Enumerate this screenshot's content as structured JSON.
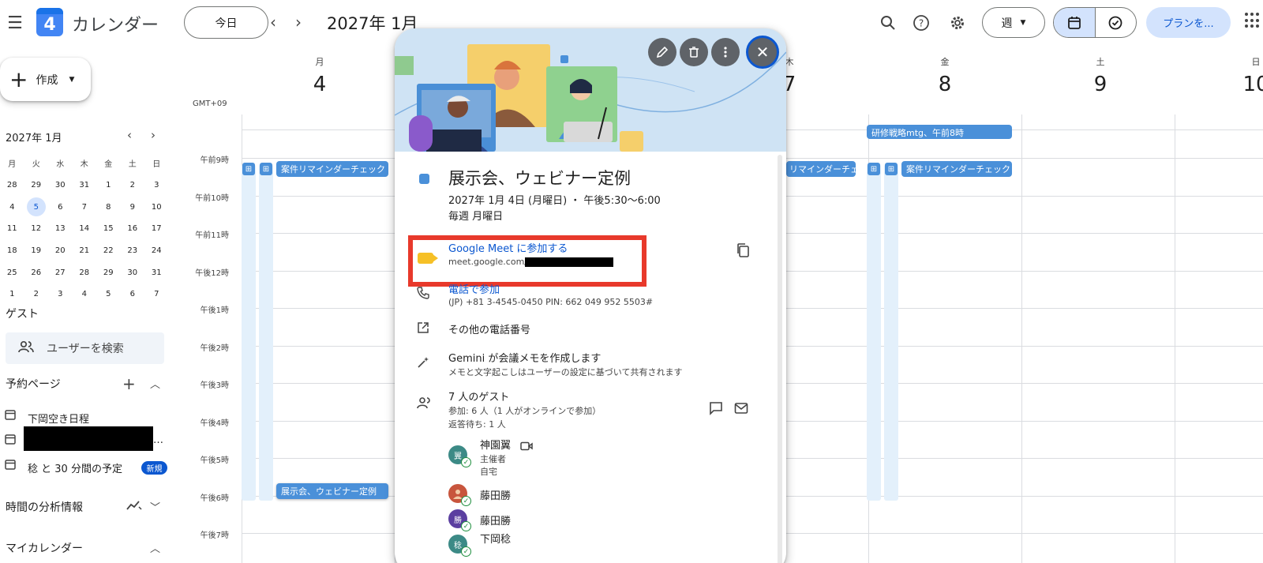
{
  "topbar": {
    "app_title": "カレンダー",
    "logo_day": "4",
    "today_label": "今日",
    "prev": "‹",
    "next": "›",
    "month_title": "2027年 1月",
    "view_label": "週",
    "plan_label": "プランを..."
  },
  "sidebar": {
    "create_label": "作成",
    "mini_title": "2027年 1月",
    "mini_prev": "‹",
    "mini_next": "›",
    "weekdays": [
      "月",
      "火",
      "水",
      "木",
      "金",
      "土",
      "日"
    ],
    "weeks": [
      [
        "28",
        "29",
        "30",
        "31",
        "1",
        "2",
        "3"
      ],
      [
        "4",
        "5",
        "6",
        "7",
        "8",
        "9",
        "10"
      ],
      [
        "11",
        "12",
        "13",
        "14",
        "15",
        "16",
        "17"
      ],
      [
        "18",
        "19",
        "20",
        "21",
        "22",
        "23",
        "24"
      ],
      [
        "25",
        "26",
        "27",
        "28",
        "29",
        "30",
        "31"
      ],
      [
        "1",
        "2",
        "3",
        "4",
        "5",
        "6",
        "7"
      ]
    ],
    "today_date": "5",
    "guest_heading": "ゲスト",
    "guest_search": "ユーザーを検索",
    "booking_heading": "予約ページ",
    "booking_items": [
      "下岡空き日程",
      "稔 と 30 分間の予定"
    ],
    "booking_ellipsis": "…",
    "new_badge": "新規",
    "insights_heading": "時間の分析情報",
    "mycal_heading": "マイカレンダー"
  },
  "grid": {
    "gmt_label": "GMT+09",
    "days": [
      {
        "dow": "月",
        "num": "4"
      },
      {
        "dow": "木",
        "num": "7"
      },
      {
        "dow": "金",
        "num": "8"
      },
      {
        "dow": "土",
        "num": "9"
      },
      {
        "dow": "日",
        "num": "10"
      }
    ],
    "times": [
      "午前9時",
      "午前10時",
      "午前11時",
      "午後12時",
      "午後1時",
      "午後2時",
      "午後3時",
      "午後4時",
      "午後5時",
      "午後6時",
      "午後7時"
    ],
    "events": {
      "reminder": "案件リマインダーチェック",
      "reminder_thu": "リマインダーチェック",
      "strategy": "研修戦略mtg、午前8時",
      "expo": "展示会、ウェビナー定例"
    },
    "mark_glyph": "⊞"
  },
  "popup": {
    "title": "展示会、ウェビナー定例",
    "datetime": "2027年 1月 4日 (月曜日) ・ 午後5:30～6:00",
    "recurrence": "毎週 月曜日",
    "meet_link": "Google Meet に参加する",
    "meet_url": "meet.google.com/",
    "phone_link": "電話で参加",
    "phone_detail": "(JP) +81 3-4545-0450 PIN: 662 049 952 5503#",
    "more_numbers": "その他の電話番号",
    "gemini_title": "Gemini が会議メモを作成します",
    "gemini_sub": "メモと文字起こしはユーザーの設定に基づいて共有されます",
    "guests_title": "7 人のゲスト",
    "guests_yes": "参加: 6 人（1 人がオンラインで参加）",
    "guests_waiting": "返答待ち: 1 人",
    "guests": [
      {
        "name": "神園翼",
        "role": "主催者",
        "location": "自宅",
        "initial": "翼",
        "color": "#3c8a86"
      },
      {
        "name": "藤田勝",
        "role": "",
        "location": "",
        "initial": "",
        "color": "#c8553d"
      },
      {
        "name": "藤田勝",
        "role": "",
        "location": "",
        "initial": "勝",
        "color": "#5b3fa0"
      },
      {
        "name": "下岡稔",
        "role": "",
        "location": "",
        "initial": "稔",
        "color": "#3c8a86"
      }
    ]
  },
  "colors": {
    "accent": "#0b57d0",
    "event": "#4a90d9",
    "highlight_box": "#e8392b"
  }
}
